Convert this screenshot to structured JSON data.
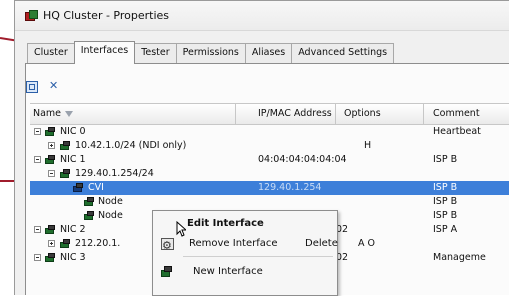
{
  "window": {
    "title": "HQ Cluster - Properties",
    "app_icon": "cluster-icon"
  },
  "tabs": [
    "Cluster",
    "Interfaces",
    "Tester",
    "Permissions",
    "Aliases",
    "Advanced Settings"
  ],
  "active_tab": "Interfaces",
  "toolbar": {
    "expand_icon": "expand-all-icon",
    "collapse_icon": "collapse-all-icon"
  },
  "grid": {
    "headers": [
      "Name",
      "IP/MAC Address",
      "Options",
      "Comment"
    ],
    "rows": [
      {
        "name": "NIC 0",
        "ip": "",
        "options": "",
        "comment": "Heartbeat"
      },
      {
        "name": "10.42.1.0/24 (NDI only)",
        "ip": "",
        "options": "H",
        "comment": ""
      },
      {
        "name": "NIC 1",
        "ip": "04:04:04:04:04:04",
        "options": "",
        "comment": "ISP B"
      },
      {
        "name": "129.40.1.254/24",
        "ip": "",
        "options": "",
        "comment": ""
      },
      {
        "name": "CVI",
        "ip": "129.40.1.254",
        "options": "",
        "comment": "ISP B"
      },
      {
        "name": "Node",
        "ip": "",
        "options": "",
        "comment": "ISP B"
      },
      {
        "name": "Node",
        "ip": "",
        "options": "",
        "comment": "ISP B"
      },
      {
        "name": "NIC 2",
        "ip": "02",
        "options": "",
        "comment": "ISP A"
      },
      {
        "name": "212.20.1.",
        "ip": "",
        "options": "A O",
        "comment": ""
      },
      {
        "name": "NIC 3",
        "ip": "02",
        "options": "",
        "comment": "Manageme"
      }
    ]
  },
  "context_menu": {
    "items": [
      {
        "label": "Edit Interface",
        "shortcut": ""
      },
      {
        "label": "Remove Interface",
        "shortcut": "Delete"
      },
      {
        "label": "New Interface",
        "shortcut": ""
      }
    ]
  },
  "colors": {
    "selection": "#3d7fd9",
    "callout": "#a01c2c"
  }
}
